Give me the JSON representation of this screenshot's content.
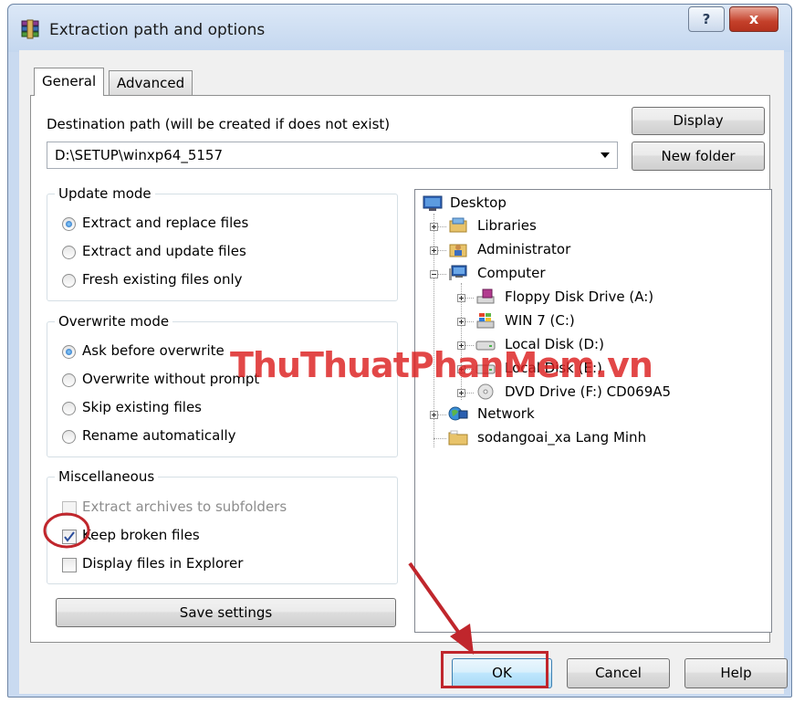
{
  "window": {
    "title": "Extraction path and options",
    "help_label": "?",
    "close_label": "x"
  },
  "tabs": [
    {
      "label": "General",
      "active": true
    },
    {
      "label": "Advanced",
      "active": false
    }
  ],
  "destination": {
    "label": "Destination path (will be created if does not exist)",
    "value": "D:\\SETUP\\winxp64_5157"
  },
  "side_buttons": {
    "display": "Display",
    "new_folder": "New folder"
  },
  "update_mode": {
    "title": "Update mode",
    "options": [
      {
        "label": "Extract and replace files",
        "selected": true
      },
      {
        "label": "Extract and update files",
        "selected": false
      },
      {
        "label": "Fresh existing files only",
        "selected": false
      }
    ]
  },
  "overwrite_mode": {
    "title": "Overwrite mode",
    "options": [
      {
        "label": "Ask before overwrite",
        "selected": true
      },
      {
        "label": "Overwrite without prompt",
        "selected": false
      },
      {
        "label": "Skip existing files",
        "selected": false
      },
      {
        "label": "Rename automatically",
        "selected": false
      }
    ]
  },
  "misc": {
    "title": "Miscellaneous",
    "options": [
      {
        "label": "Extract archives to subfolders",
        "checked": false,
        "disabled": true
      },
      {
        "label": "Keep broken files",
        "checked": true,
        "disabled": false
      },
      {
        "label": "Display files in Explorer",
        "checked": false,
        "disabled": false
      }
    ]
  },
  "save_settings": "Save settings",
  "tree": {
    "items": [
      {
        "label": "Desktop",
        "icon": "desktop-icon"
      },
      {
        "label": "Libraries",
        "icon": "libraries-icon"
      },
      {
        "label": "Administrator",
        "icon": "user-folder-icon"
      },
      {
        "label": "Computer",
        "icon": "computer-icon"
      },
      {
        "label": "Floppy Disk Drive (A:)",
        "icon": "floppy-drive-icon"
      },
      {
        "label": "WIN 7 (C:)",
        "icon": "windows-drive-icon"
      },
      {
        "label": "Local Disk (D:)",
        "icon": "hard-drive-icon"
      },
      {
        "label": "Local Disk (E:)",
        "icon": "hard-drive-icon"
      },
      {
        "label": "DVD Drive (F:) CD069A5",
        "icon": "dvd-drive-icon"
      },
      {
        "label": "Network",
        "icon": "network-icon"
      },
      {
        "label": "sodangoai_xa Lang Minh",
        "icon": "folder-icon"
      }
    ]
  },
  "footer": {
    "ok": "OK",
    "cancel": "Cancel",
    "help": "Help"
  },
  "watermark": "ThuThuatPhanMem.vn",
  "colors": {
    "annotation_red": "#c0262c",
    "watermark_red": "#dc1e1e",
    "titlebar_blue": "#c4d7ef"
  }
}
